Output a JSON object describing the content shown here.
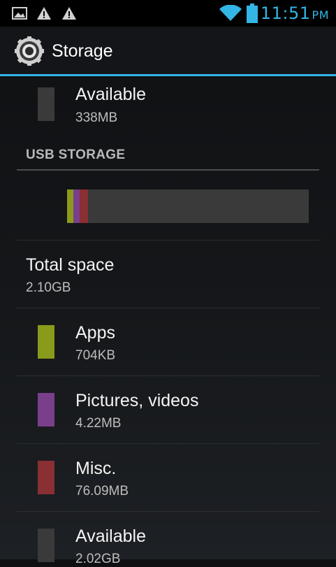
{
  "status_bar": {
    "time": "11:51",
    "ampm": "PM",
    "icons": [
      "picture-icon",
      "warning-icon",
      "warning-icon",
      "wifi-icon",
      "battery-icon"
    ],
    "accent": "#33b5e5"
  },
  "action_bar": {
    "title": "Storage",
    "icon": "settings-gear-icon"
  },
  "internal_top": {
    "label": "Available",
    "value": "338MB",
    "color": "#3a3a3a"
  },
  "usb_storage": {
    "header": "USB STORAGE",
    "usage_bar": {
      "segments": [
        {
          "name": "Apps",
          "color": "#8a9a1a",
          "fraction": 0.025
        },
        {
          "name": "Pictures, videos",
          "color": "#7a3f8a",
          "fraction": 0.028
        },
        {
          "name": "Misc.",
          "color": "#8a2f33",
          "fraction": 0.035
        }
      ],
      "remainder_color": "#3a3a3a"
    },
    "total": {
      "label": "Total space",
      "value": "2.10GB"
    },
    "items": [
      {
        "label": "Apps",
        "value": "704KB",
        "color": "#8a9a1a"
      },
      {
        "label": "Pictures, videos",
        "value": "4.22MB",
        "color": "#7a3f8a"
      },
      {
        "label": "Misc.",
        "value": "76.09MB",
        "color": "#8a2f33"
      },
      {
        "label": "Available",
        "value": "2.02GB",
        "color": "#3a3a3a"
      }
    ]
  }
}
